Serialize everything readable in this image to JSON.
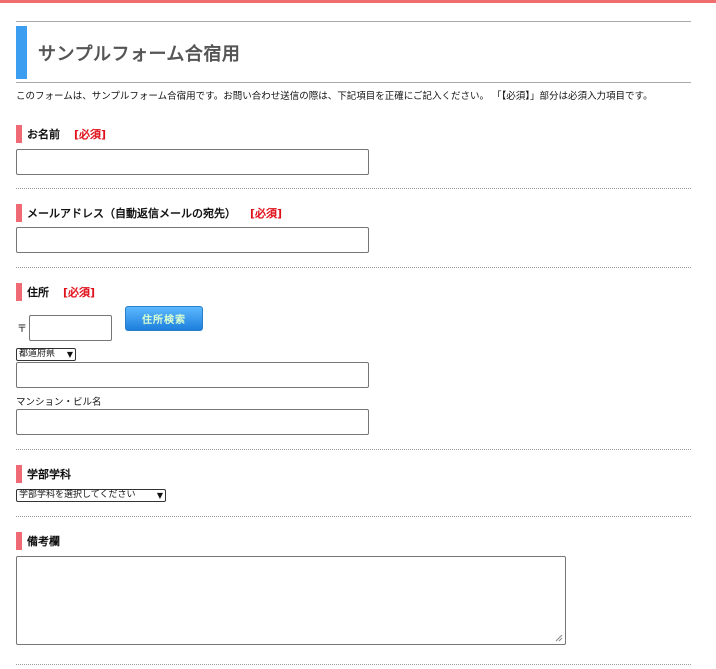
{
  "page": {
    "title": "サンプルフォーム合宿用",
    "intro": "このフォームは、サンプルフォーム合宿用です。お問い合わせ送信の際は、下記項目を正確にご記入ください。 「【必須】」部分は必須入力項目です。",
    "accent_color": "#3c9ef0",
    "top_bar_color": "#ef6d6d"
  },
  "required_label": "[必須]",
  "fields": {
    "name": {
      "label": "お名前",
      "value": ""
    },
    "email": {
      "label": "メールアドレス（自動返信メールの宛先）",
      "value": ""
    },
    "address": {
      "label": "住所",
      "zip_mark": "〒",
      "zip_value": "",
      "zip_search_button": "住所検索",
      "prefecture_selected": "都道府県",
      "line_value": "",
      "building_label": "マンション・ビル名",
      "building_value": ""
    },
    "faculty": {
      "label": "学部学科",
      "selected": "学部学科を選択してください"
    },
    "notes": {
      "label": "備考欄",
      "value": ""
    }
  },
  "colors": {
    "section_accent": "#f06a75",
    "required": "#e0101a",
    "button_bg": "#1d7fdc",
    "button_text": "#d8ffd0"
  }
}
